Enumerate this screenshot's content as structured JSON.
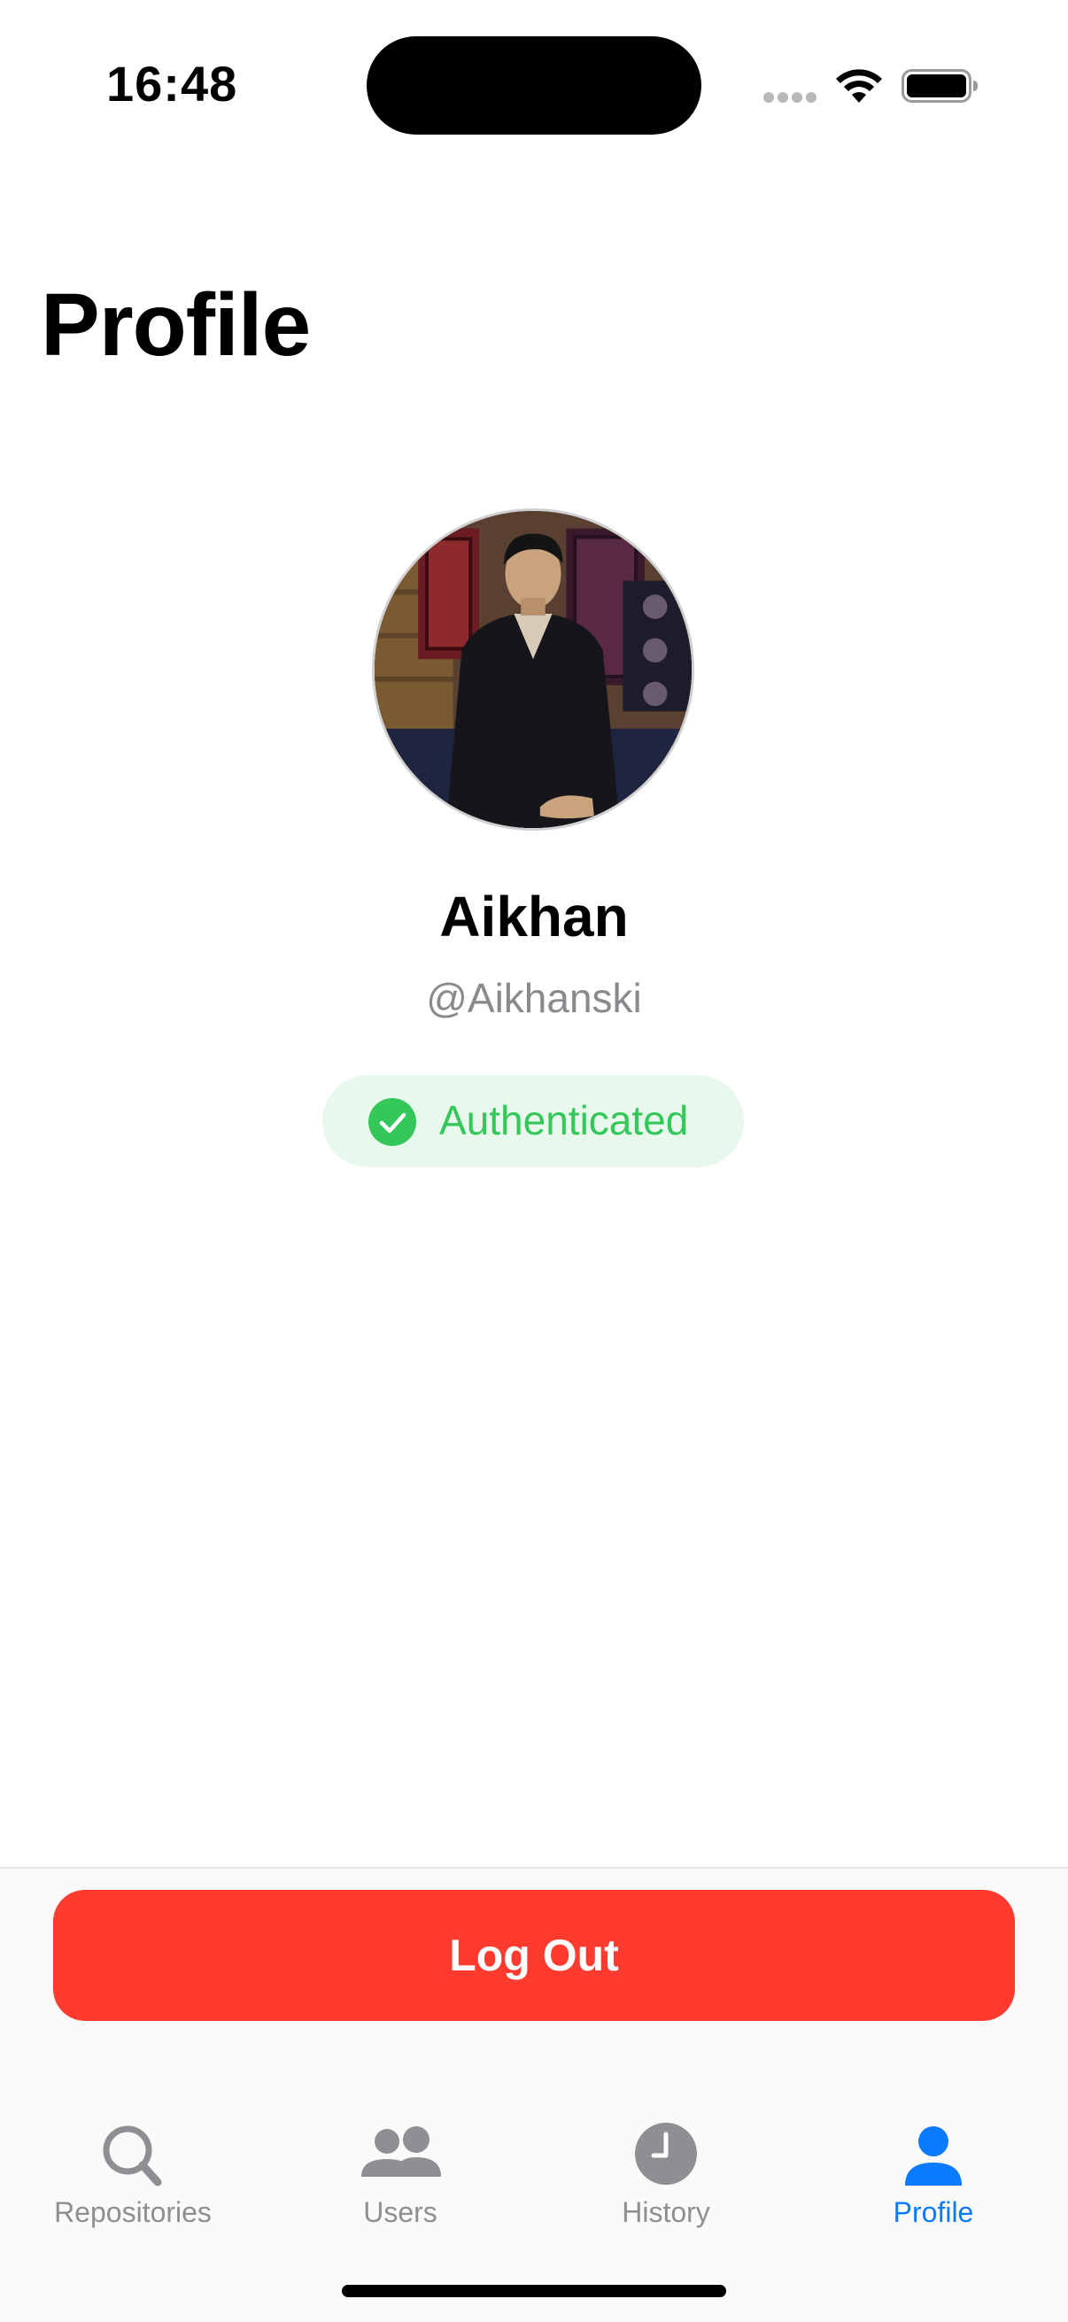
{
  "status_bar": {
    "time": "16:48",
    "icons": [
      "cellular-signal-icon",
      "wifi-icon",
      "battery-icon"
    ]
  },
  "page": {
    "title": "Profile"
  },
  "profile": {
    "avatar": "avatar-photo",
    "name": "Aikhan",
    "handle": "@Aikhanski",
    "status": {
      "icon": "checkmark-circle-icon",
      "label": "Authenticated",
      "color": "#34c759",
      "background": "#e9f8ec"
    }
  },
  "actions": {
    "logout_label": "Log Out",
    "logout_color": "#ff3b30"
  },
  "tabbar": {
    "active_color": "#0a7aff",
    "inactive_color": "#8e8e93",
    "tabs": [
      {
        "label": "Repositories",
        "icon": "magnifying-glass-icon",
        "active": false
      },
      {
        "label": "Users",
        "icon": "users-icon",
        "active": false
      },
      {
        "label": "History",
        "icon": "clock-icon",
        "active": false
      },
      {
        "label": "Profile",
        "icon": "person-icon",
        "active": true
      }
    ]
  }
}
